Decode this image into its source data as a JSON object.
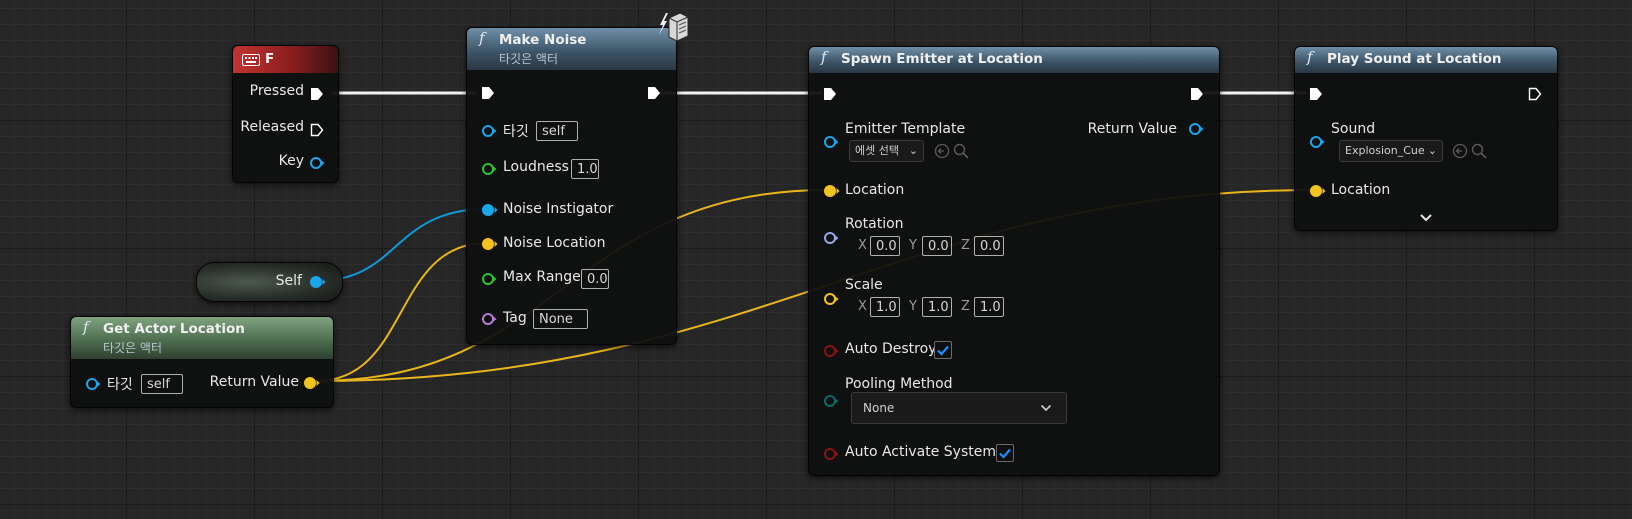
{
  "colors": {
    "exec": "#ffffff",
    "object": "#1aa6e8",
    "vector": "#f2c21e",
    "float": "#2ec42e",
    "name": "#b47ad8",
    "rotator": "#9aa6e6",
    "bool": "#8a1414",
    "enum": "#0b6b63"
  },
  "key_node": {
    "title": "F",
    "icon": "keyboard-icon",
    "pins": {
      "pressed": "Pressed",
      "released": "Released",
      "key": "Key"
    }
  },
  "self_node": {
    "label": "Self"
  },
  "get_actor_location": {
    "title": "Get Actor Location",
    "subtitle": "타깃은 액터",
    "target_label": "타깃",
    "target_value": "self",
    "return_label": "Return Value"
  },
  "make_noise": {
    "title": "Make Noise",
    "subtitle": "타깃은 액터",
    "icons": [
      "lightning-icon",
      "server-icon"
    ],
    "target_label": "타깃",
    "target_value": "self",
    "loudness_label": "Loudness",
    "loudness_value": "1.0",
    "instigator_label": "Noise Instigator",
    "location_label": "Noise Location",
    "max_range_label": "Max Range",
    "max_range_value": "0.0",
    "tag_label": "Tag",
    "tag_value": "None"
  },
  "spawn_emitter": {
    "title": "Spawn Emitter at Location",
    "emitter_label": "Emitter Template",
    "emitter_value": "에셋 선택",
    "return_label": "Return Value",
    "location_label": "Location",
    "rotation_label": "Rotation",
    "rotation": {
      "x": "0.0",
      "y": "0.0",
      "z": "0.0"
    },
    "scale_label": "Scale",
    "scale": {
      "x": "1.0",
      "y": "1.0",
      "z": "1.0"
    },
    "axis": {
      "x": "X",
      "y": "Y",
      "z": "Z"
    },
    "auto_destroy_label": "Auto Destroy",
    "auto_destroy": true,
    "pooling_label": "Pooling Method",
    "pooling_value": "None",
    "auto_activate_label": "Auto Activate System",
    "auto_activate": true
  },
  "play_sound": {
    "title": "Play Sound at Location",
    "sound_label": "Sound",
    "sound_value": "Explosion_Cue",
    "location_label": "Location"
  }
}
